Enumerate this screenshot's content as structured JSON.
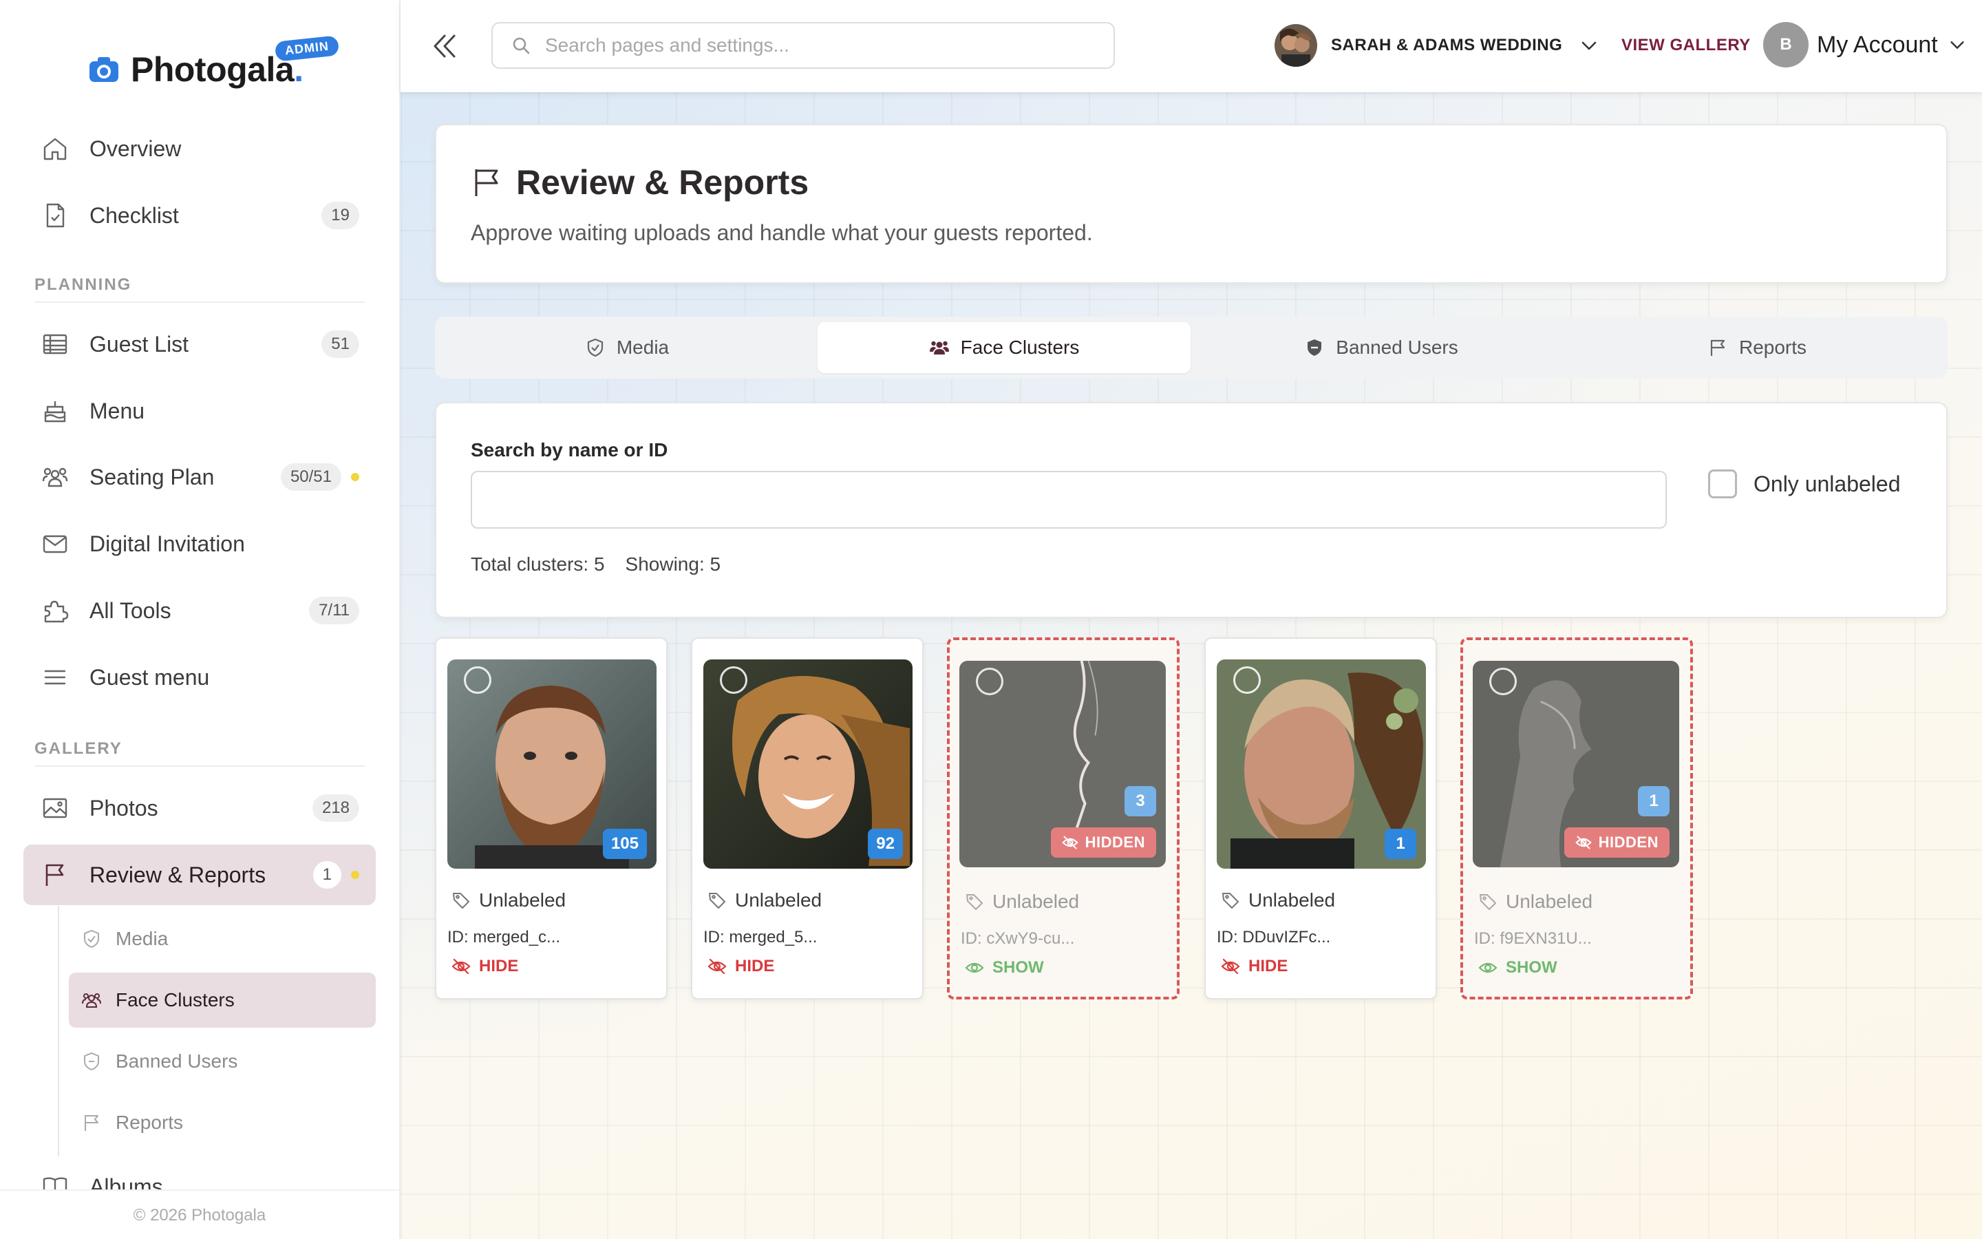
{
  "app": {
    "name": "Photogala",
    "name_dot": ".",
    "admin_badge": "ADMIN",
    "footer": "© 2026 Photogala"
  },
  "sidebar": {
    "items": [
      {
        "label": "Overview",
        "icon": "home-icon"
      },
      {
        "label": "Checklist",
        "icon": "checklist-icon",
        "count": "19"
      },
      {
        "label": "Guest List",
        "icon": "table-icon",
        "count": "51"
      },
      {
        "label": "Menu",
        "icon": "cake-icon"
      },
      {
        "label": "Seating Plan",
        "icon": "users-icon",
        "count": "50/51"
      },
      {
        "label": "Digital Invitation",
        "icon": "mail-icon"
      },
      {
        "label": "All Tools",
        "icon": "puzzle-icon",
        "count": "7/11"
      },
      {
        "label": "Guest menu",
        "icon": "hamburger-icon"
      },
      {
        "label": "Photos",
        "icon": "image-icon",
        "count": "218"
      },
      {
        "label": "Review & Reports",
        "icon": "flag-icon",
        "count": "1"
      },
      {
        "label": "Albums",
        "icon": "book-icon"
      }
    ],
    "sections": {
      "planning": "PLANNING",
      "gallery": "GALLERY"
    },
    "subitems": [
      {
        "label": "Media"
      },
      {
        "label": "Face Clusters"
      },
      {
        "label": "Banned Users"
      },
      {
        "label": "Reports"
      }
    ]
  },
  "topbar": {
    "search_placeholder": "Search pages and settings...",
    "event_name": "SARAH & ADAMS WEDDING",
    "view_gallery": "VIEW GALLERY",
    "account_initial": "B",
    "account_label": "My Account"
  },
  "page": {
    "title": "Review & Reports",
    "subtitle": "Approve waiting uploads and handle what your guests reported."
  },
  "tabs": [
    {
      "label": "Media"
    },
    {
      "label": "Face Clusters",
      "active": true
    },
    {
      "label": "Banned Users"
    },
    {
      "label": "Reports"
    }
  ],
  "filter": {
    "search_label": "Search by name or ID",
    "search_value": "",
    "only_unlabeled": "Only unlabeled",
    "total": "Total clusters: 5",
    "showing": "Showing: 5"
  },
  "clusters": [
    {
      "count": "105",
      "label": "Unlabeled",
      "id": "ID: merged_c...",
      "action": "HIDE",
      "hidden": false
    },
    {
      "count": "92",
      "label": "Unlabeled",
      "id": "ID: merged_5...",
      "action": "HIDE",
      "hidden": false
    },
    {
      "count": "3",
      "label": "Unlabeled",
      "id": "ID: cXwY9-cu...",
      "action": "SHOW",
      "hidden": true,
      "hidden_badge": "HIDDEN"
    },
    {
      "count": "1",
      "label": "Unlabeled",
      "id": "ID: DDuvIZFc...",
      "action": "HIDE",
      "hidden": false
    },
    {
      "count": "1",
      "label": "Unlabeled",
      "id": "ID: f9EXN31U...",
      "action": "SHOW",
      "hidden": true,
      "hidden_badge": "HIDDEN"
    }
  ],
  "colors": {
    "accent": "#2f7de1",
    "active_nav": "#e9dde2",
    "hide": "#d93a3a",
    "show": "#6fb86f",
    "hidden_border": "#d95858",
    "view_gallery": "#7a1f3d"
  }
}
